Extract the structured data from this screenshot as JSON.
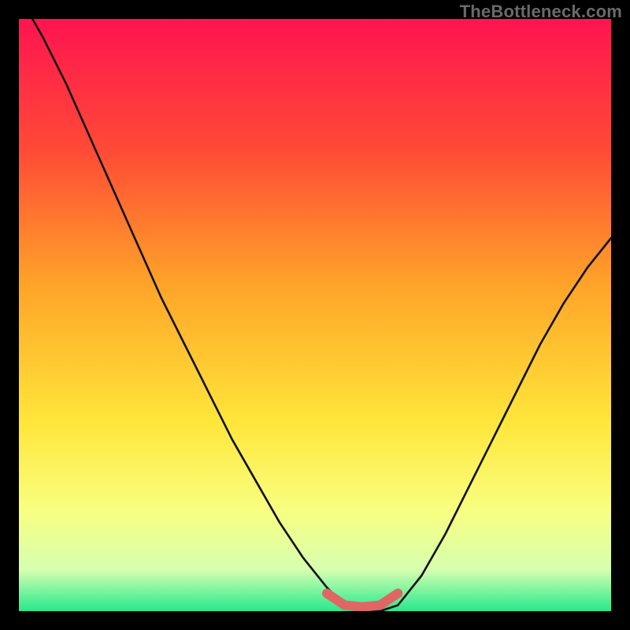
{
  "watermark": "TheBottleneck.com",
  "colors": {
    "bg_black": "#000000",
    "grad_top": "#ff1450",
    "grad_mid1": "#ff5a2a",
    "grad_mid2": "#ffa428",
    "grad_mid3": "#ffe63a",
    "grad_low1": "#f8ff80",
    "grad_low2": "#d6ffb0",
    "grad_bottom": "#27e98e",
    "curve_black": "#111111",
    "marker_red": "#e06666"
  },
  "chart_data": {
    "type": "line",
    "title": "",
    "xlabel": "",
    "ylabel": "",
    "xlim": [
      0,
      100
    ],
    "ylim": [
      0,
      100
    ],
    "series": [
      {
        "name": "bottleneck-curve",
        "x": [
          0,
          4,
          8,
          12,
          16,
          20,
          24,
          28,
          32,
          36,
          40,
          44,
          48,
          52,
          55,
          58,
          61,
          64,
          68,
          72,
          76,
          80,
          84,
          88,
          92,
          96,
          100
        ],
        "y": [
          104,
          97,
          89,
          80,
          71,
          62,
          53,
          45,
          37,
          29,
          22,
          15,
          9,
          4,
          1,
          0,
          0,
          1,
          6,
          13,
          21,
          29,
          37,
          45,
          52,
          58,
          63
        ]
      },
      {
        "name": "optimal-band-marker",
        "x": [
          52,
          55,
          58,
          61,
          64
        ],
        "y": [
          3,
          1,
          0.7,
          1,
          3
        ]
      }
    ],
    "gradient_stops": [
      {
        "pos": 0.0,
        "color": "#ff1450"
      },
      {
        "pos": 0.22,
        "color": "#ff4a36"
      },
      {
        "pos": 0.45,
        "color": "#ffa428"
      },
      {
        "pos": 0.68,
        "color": "#ffe63a"
      },
      {
        "pos": 0.83,
        "color": "#f8ff80"
      },
      {
        "pos": 0.93,
        "color": "#d6ffb0"
      },
      {
        "pos": 1.0,
        "color": "#27e98e"
      }
    ]
  }
}
